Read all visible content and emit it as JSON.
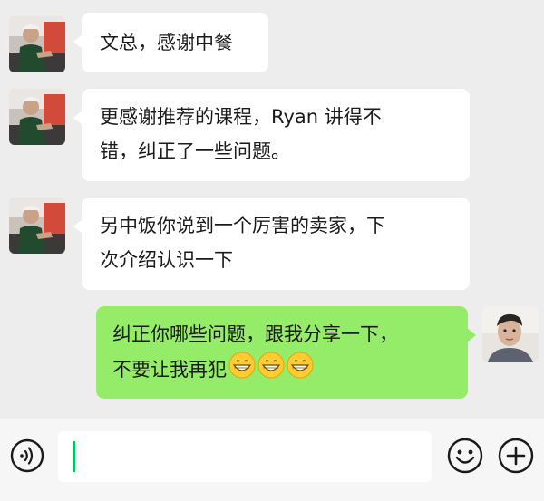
{
  "messages": [
    {
      "direction": "incoming",
      "text": "文总，感谢中餐"
    },
    {
      "direction": "incoming",
      "line1": "更感谢推荐的课程，Ryan 讲得不",
      "line2": "错，纠正了一些问题。"
    },
    {
      "direction": "incoming",
      "line1": "另中饭你说到一个厉害的卖家，下",
      "line2": "次介绍认识一下"
    },
    {
      "direction": "outgoing",
      "line1": "纠正你哪些问题，跟我分享一下，",
      "line2": "不要让我再犯",
      "emoji": "grinning-face-emoji",
      "emoji_count": 3
    }
  ],
  "input": {
    "value": ""
  },
  "icons": {
    "voice": "voice-icon",
    "emoji": "emoji-icon",
    "add": "plus-icon"
  },
  "colors": {
    "outgoing_bubble": "#95ec69",
    "incoming_bubble": "#ffffff",
    "background": "#ededed",
    "caret": "#07c160"
  }
}
